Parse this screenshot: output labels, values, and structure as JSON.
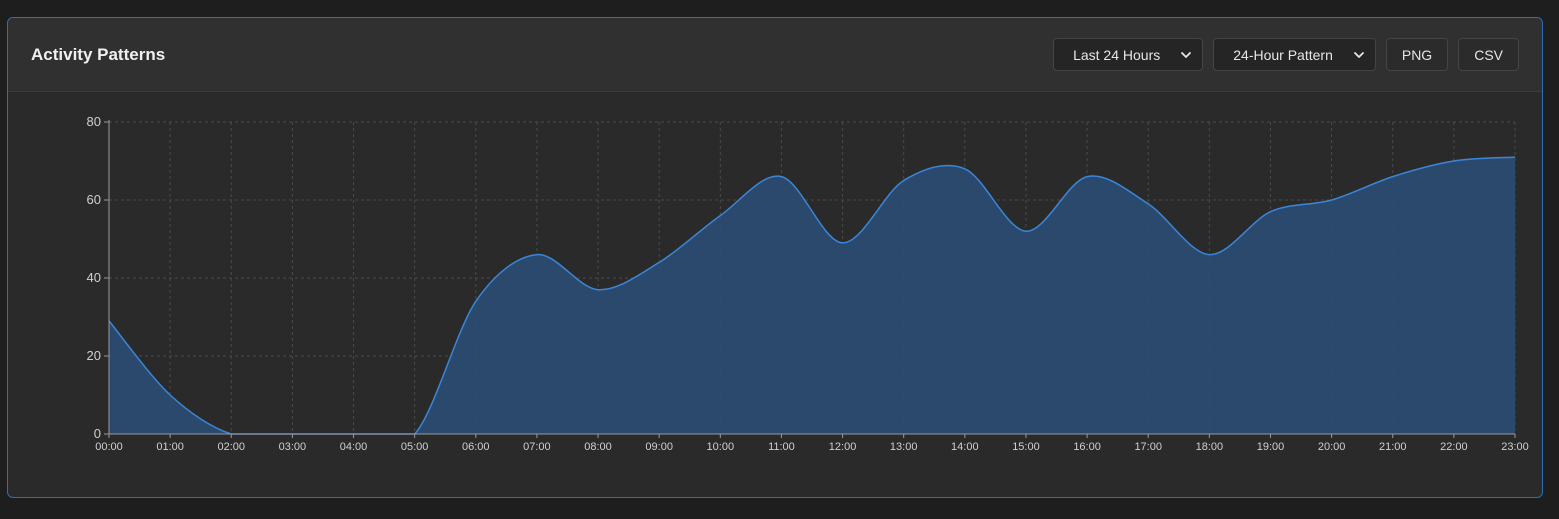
{
  "panel": {
    "title": "Activity Patterns"
  },
  "controls": {
    "range_select": "Last 24 Hours",
    "pattern_select": "24-Hour Pattern",
    "png_label": "PNG",
    "csv_label": "CSV"
  },
  "colors": {
    "line": "#3a86d8",
    "fill": "#2b4c74",
    "grid": "#4a4a4a",
    "axis": "#9a9a9a",
    "border_accent": "#2f6db5"
  },
  "chart_data": {
    "type": "area",
    "categories": [
      "00:00",
      "01:00",
      "02:00",
      "03:00",
      "04:00",
      "05:00",
      "06:00",
      "07:00",
      "08:00",
      "09:00",
      "10:00",
      "11:00",
      "12:00",
      "13:00",
      "14:00",
      "15:00",
      "16:00",
      "17:00",
      "18:00",
      "19:00",
      "20:00",
      "21:00",
      "22:00",
      "23:00"
    ],
    "values": [
      29,
      10,
      0,
      0,
      0,
      0,
      34,
      46,
      37,
      44,
      56,
      66,
      49,
      65,
      68,
      52,
      66,
      59,
      46,
      57,
      60,
      66,
      70,
      71
    ],
    "ylim": [
      0,
      80
    ],
    "yticks": [
      0,
      20,
      40,
      60,
      80
    ],
    "grid": true,
    "smooth": true,
    "title": "",
    "xlabel": "",
    "ylabel": ""
  }
}
